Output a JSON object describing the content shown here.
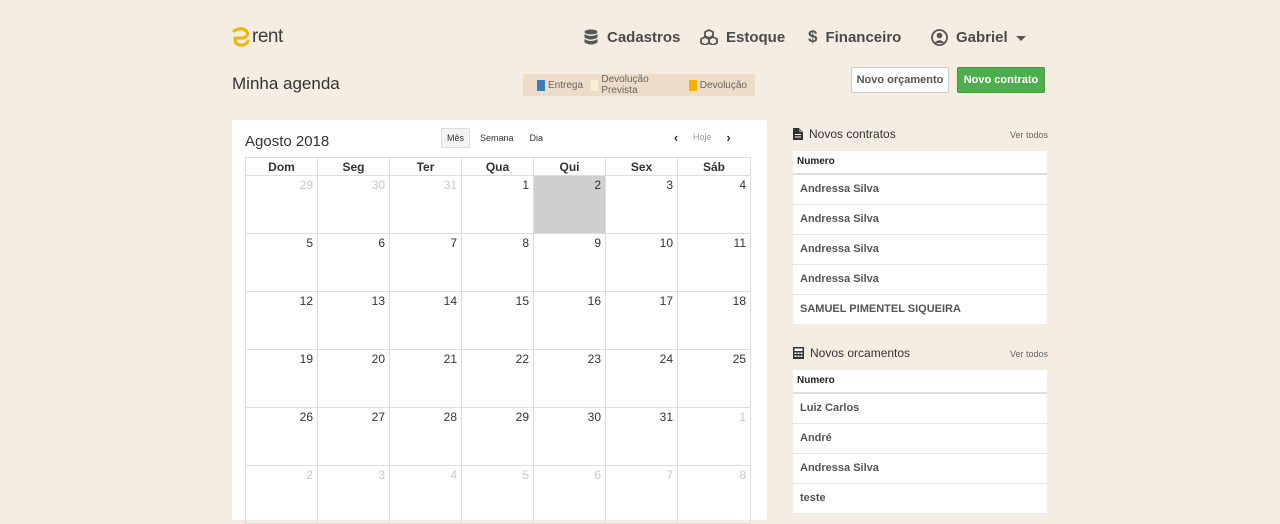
{
  "brand": {
    "logo_text": "rent",
    "accent": "#f0b400"
  },
  "nav": {
    "cadastros": "Cadastros",
    "estoque": "Estoque",
    "financeiro": "Financeiro",
    "user": "Gabriel"
  },
  "page": {
    "title": "Minha agenda"
  },
  "legend": [
    {
      "label": "Entrega",
      "color": "#3a7fb8"
    },
    {
      "label": "Devolução Prevista",
      "color": "#f7f0d6"
    },
    {
      "label": "Devolução",
      "color": "#f0b400"
    }
  ],
  "actions": {
    "novo_orcamento": "Novo orçamento",
    "novo_contrato": "Novo contrato"
  },
  "calendar": {
    "title": "Agosto 2018",
    "views": [
      "Mês",
      "Semana",
      "Dia"
    ],
    "active_view": "Mês",
    "today_label": "Hoje",
    "weekdays": [
      "Dom",
      "Seg",
      "Ter",
      "Qua",
      "Qui",
      "Sex",
      "Sáb"
    ],
    "weeks": [
      [
        "29",
        "30",
        "31",
        "1",
        "2",
        "3",
        "4"
      ],
      [
        "5",
        "6",
        "7",
        "8",
        "9",
        "10",
        "11"
      ],
      [
        "12",
        "13",
        "14",
        "15",
        "16",
        "17",
        "18"
      ],
      [
        "19",
        "20",
        "21",
        "22",
        "23",
        "24",
        "25"
      ],
      [
        "26",
        "27",
        "28",
        "29",
        "30",
        "31",
        "1"
      ],
      [
        "2",
        "3",
        "4",
        "5",
        "6",
        "7",
        "8"
      ]
    ],
    "today": "2"
  },
  "contratos": {
    "title": "Novos contratos",
    "ver_todos": "Ver todos",
    "column": "Numero",
    "rows": [
      "Andressa Silva",
      "Andressa Silva",
      "Andressa Silva",
      "Andressa Silva",
      "SAMUEL PIMENTEL SIQUEIRA"
    ]
  },
  "orcamentos": {
    "title": "Novos orcamentos",
    "ver_todos": "Ver todos",
    "column": "Numero",
    "rows": [
      "Luiz Carlos",
      "André",
      "Andressa Silva",
      "teste"
    ]
  }
}
